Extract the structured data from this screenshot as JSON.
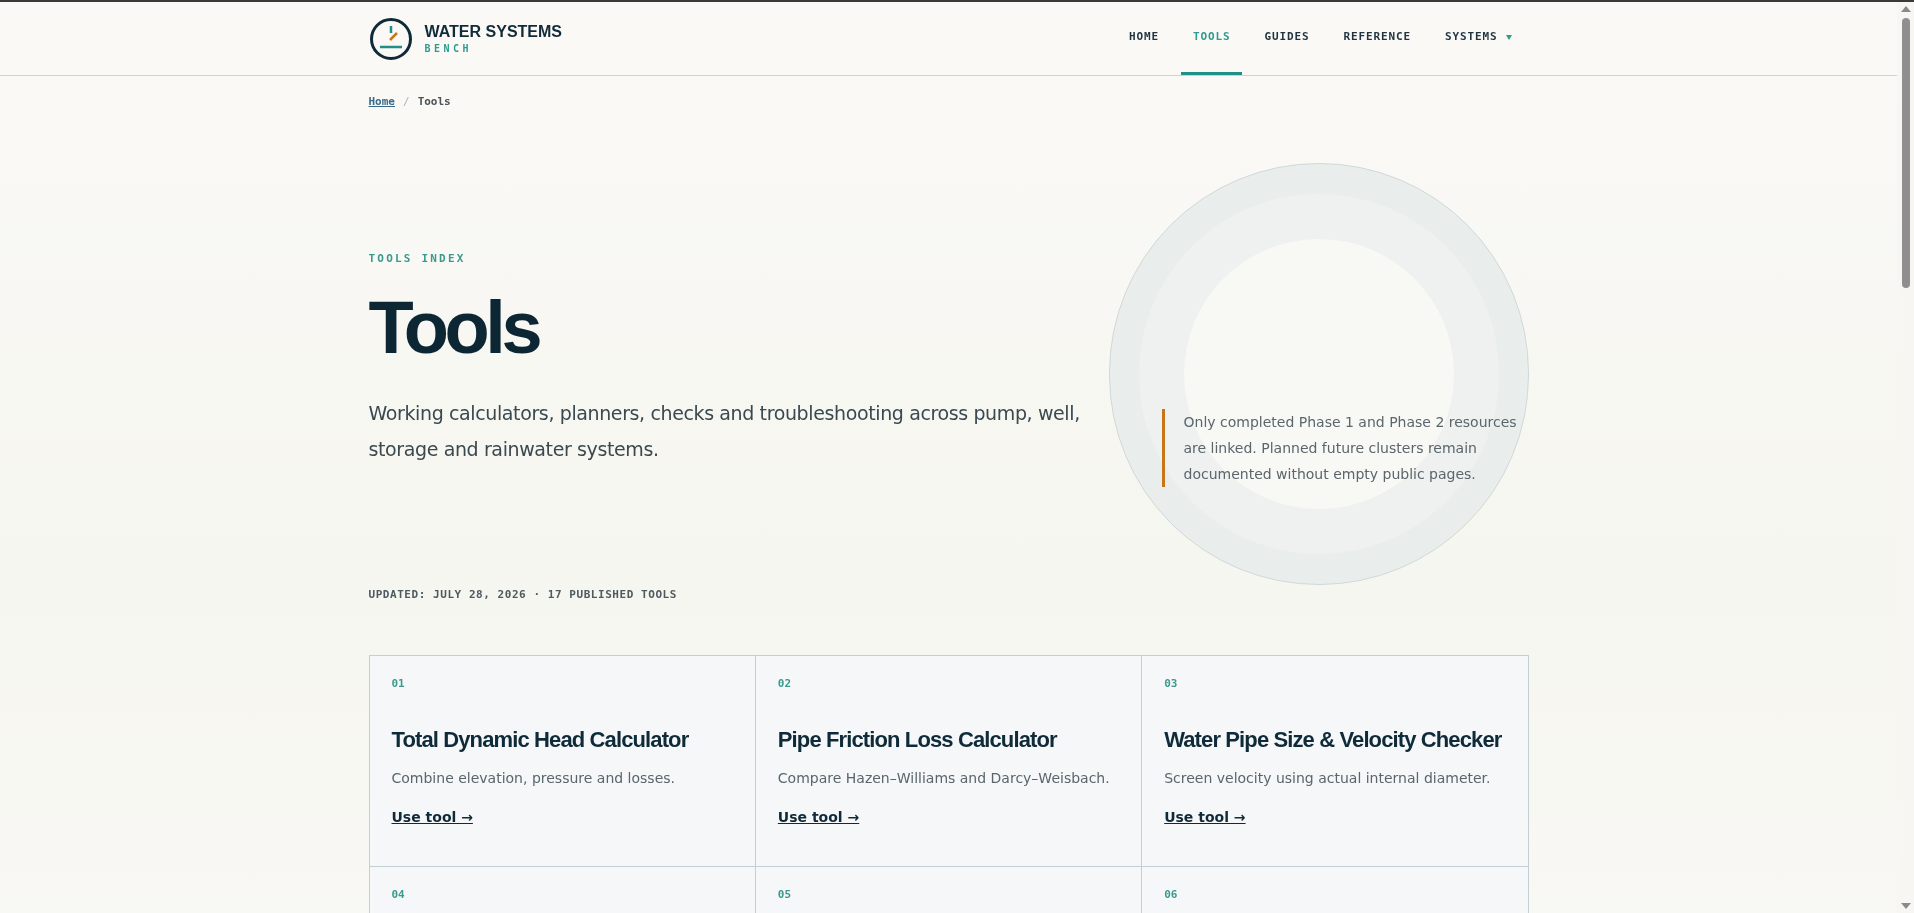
{
  "brand": {
    "name": "WATER SYSTEMS",
    "sub": "BENCH"
  },
  "nav": [
    {
      "label": "HOME",
      "selected": false,
      "dropdown": false
    },
    {
      "label": "TOOLS",
      "selected": true,
      "dropdown": false
    },
    {
      "label": "GUIDES",
      "selected": false,
      "dropdown": false
    },
    {
      "label": "REFERENCE",
      "selected": false,
      "dropdown": false
    },
    {
      "label": "SYSTEMS",
      "selected": false,
      "dropdown": true
    }
  ],
  "breadcrumb": [
    {
      "label": "Home",
      "link": true
    },
    {
      "label": "Tools",
      "link": false
    }
  ],
  "breadcrumb_separator": "/",
  "hero": {
    "eyebrow": "TOOLS INDEX",
    "title": "Tools",
    "description": "Working calculators, planners, checks and troubleshooting across pump, well, storage and rainwater systems.",
    "note": "Only completed Phase 1 and Phase 2 resources are linked. Planned future clusters remain documented without empty public pages."
  },
  "meta": "UPDATED: JULY 28, 2026 · 17 PUBLISHED TOOLS",
  "cards": [
    {
      "number": "01",
      "title": "Total Dynamic Head Calculator",
      "description": "Combine elevation, pressure and losses.",
      "link": "Use tool →"
    },
    {
      "number": "02",
      "title": "Pipe Friction Loss Calculator",
      "description": "Compare Hazen–Williams and Darcy–Weisbach.",
      "link": "Use tool →"
    },
    {
      "number": "03",
      "title": "Water Pipe Size & Velocity Checker",
      "description": "Screen velocity using actual internal diameter.",
      "link": "Use tool →"
    },
    {
      "number": "04"
    },
    {
      "number": "05"
    },
    {
      "number": "06"
    }
  ]
}
